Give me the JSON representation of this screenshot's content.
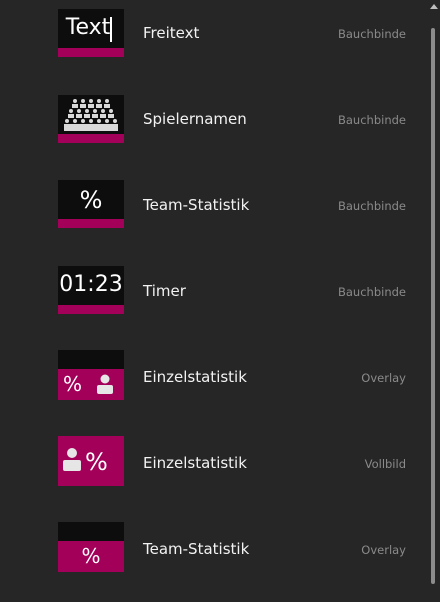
{
  "items": [
    {
      "label": "Freitext",
      "type": "Bauchbinde",
      "thumb_text": "Text",
      "icon": "text-cursor-icon"
    },
    {
      "label": "Spielernamen",
      "type": "Bauchbinde",
      "thumb_text": "",
      "icon": "people-grid-icon"
    },
    {
      "label": "Team-Statistik",
      "type": "Bauchbinde",
      "thumb_text": "%",
      "icon": "percent-icon"
    },
    {
      "label": "Timer",
      "type": "Bauchbinde",
      "thumb_text": "01:23",
      "icon": "timer-icon"
    },
    {
      "label": "Einzelstatistik",
      "type": "Overlay",
      "thumb_text": "%",
      "icon": "percent-person-icon"
    },
    {
      "label": "Einzelstatistik",
      "type": "Vollbild",
      "thumb_text": "%",
      "icon": "person-percent-icon"
    },
    {
      "label": "Team-Statistik",
      "type": "Overlay",
      "thumb_text": "%",
      "icon": "percent-icon"
    }
  ],
  "colors": {
    "accent": "#a3005a",
    "background": "#262626",
    "thumb_bg": "#0d0d0d"
  }
}
